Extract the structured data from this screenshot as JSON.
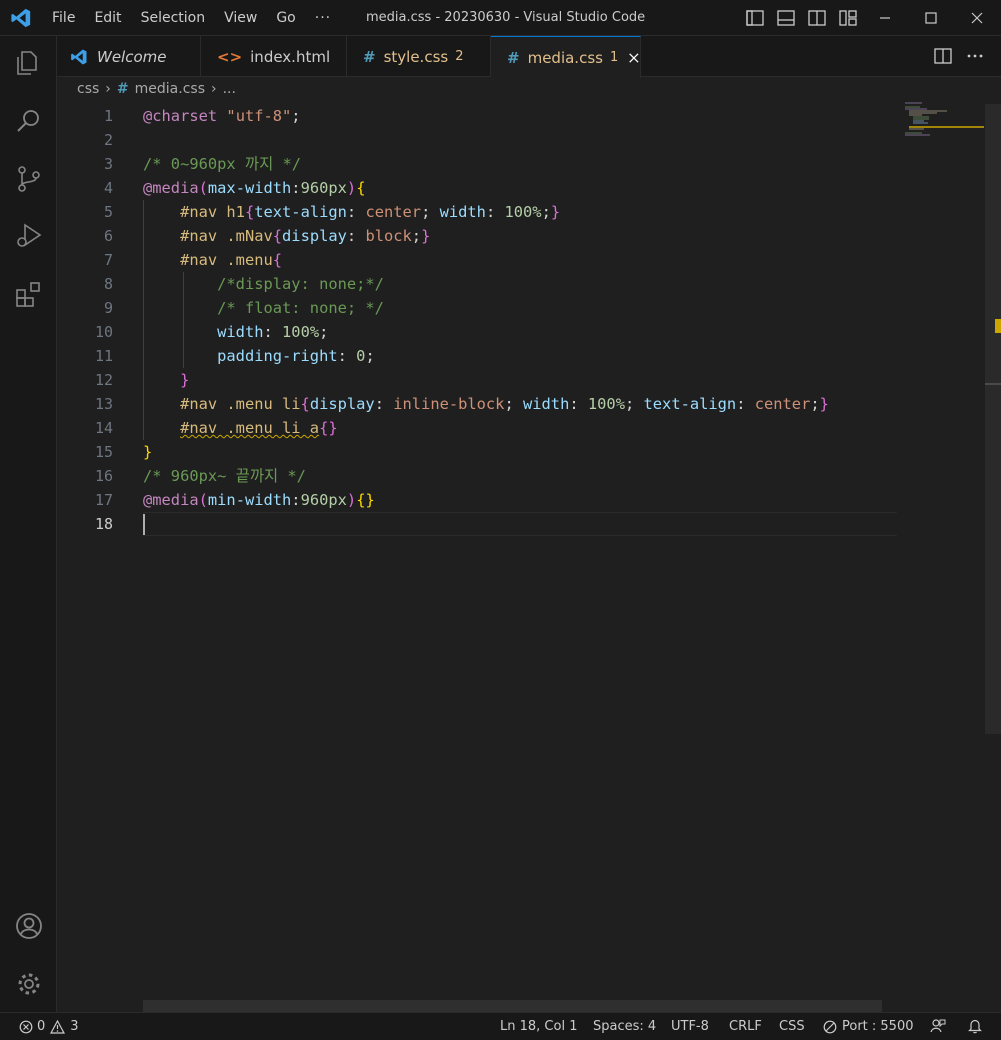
{
  "window": {
    "title": "media.css - 20230630 - Visual Studio Code",
    "menu": [
      "File",
      "Edit",
      "Selection",
      "View",
      "Go",
      "···"
    ]
  },
  "activity_bar": {
    "top": [
      "explorer-icon",
      "search-icon",
      "source-control-icon",
      "run-debug-icon",
      "extensions-icon"
    ],
    "bottom": [
      "accounts-icon",
      "manage-gear-icon"
    ]
  },
  "tabs": [
    {
      "label": "Welcome",
      "icon": "vscode-icon",
      "italic": true,
      "active": false
    },
    {
      "label": "index.html",
      "icon": "html-icon",
      "active": false
    },
    {
      "label": "style.css",
      "icon": "css-hash-icon",
      "badge": "2",
      "active": false,
      "color": "#e2c08d"
    },
    {
      "label": "media.css",
      "icon": "css-hash-icon",
      "badge": "1",
      "active": true,
      "color": "#e2c08d"
    }
  ],
  "breadcrumb": {
    "folder": "css",
    "file": "media.css",
    "more": "..."
  },
  "editor": {
    "current_line": 18,
    "line_numbers": [
      "1",
      "2",
      "3",
      "4",
      "5",
      "6",
      "7",
      "8",
      "9",
      "10",
      "11",
      "12",
      "13",
      "14",
      "15",
      "16",
      "17",
      "18"
    ]
  },
  "code": {
    "l1a": "@charset",
    "l1b": "\"utf-8\"",
    "l1c": ";",
    "l3": "/* 0~960px 까지 */",
    "l4a": "@media",
    "l4b": "(",
    "l4c": "max-width",
    "l4d": ":",
    "l4e": "960px",
    "l4f": ")",
    "l4g": "{",
    "l5a": "#nav h1",
    "l5b": "{",
    "l5c": "text-align",
    "l5d": ": ",
    "l5e": "center",
    "l5f": "; ",
    "l5g": "width",
    "l5h": ": ",
    "l5i": "100%",
    "l5j": ";",
    "l5k": "}",
    "l6a": "#nav .mNav",
    "l6b": "{",
    "l6c": "display",
    "l6d": ": ",
    "l6e": "block",
    "l6f": ";",
    "l6g": "}",
    "l7a": "#nav .menu",
    "l7b": "{",
    "l8": "/*display: none;*/",
    "l9": "/* float: none; */",
    "l10a": "width",
    "l10b": ": ",
    "l10c": "100%",
    "l10d": ";",
    "l11a": "padding-right",
    "l11b": ": ",
    "l11c": "0",
    "l11d": ";",
    "l12": "}",
    "l13a": "#nav .menu li",
    "l13b": "{",
    "l13c": "display",
    "l13d": ": ",
    "l13e": "inline-block",
    "l13f": "; ",
    "l13g": "width",
    "l13h": ": ",
    "l13i": "100%",
    "l13j": "; ",
    "l13k": "text-align",
    "l13l": ": ",
    "l13m": "center",
    "l13n": ";",
    "l13o": "}",
    "l14a": "#nav .menu li a",
    "l14b": "{}",
    "l15": "}",
    "l16": "/* 960px~ 끝까지 */",
    "l17a": "@media",
    "l17b": "(",
    "l17c": "min-width",
    "l17d": ":",
    "l17e": "960px",
    "l17f": ")",
    "l17g": "{}"
  },
  "status_bar": {
    "errors": "0",
    "warnings": "3",
    "position": "Ln 18, Col 1",
    "spaces": "Spaces: 4",
    "encoding": "UTF-8",
    "eol": "CRLF",
    "language": "CSS",
    "port": "Port : 5500"
  },
  "colors": {
    "accent": "#0078d4",
    "warning": "#cca700",
    "keyword": "#c586c0",
    "comment": "#6a9955"
  }
}
